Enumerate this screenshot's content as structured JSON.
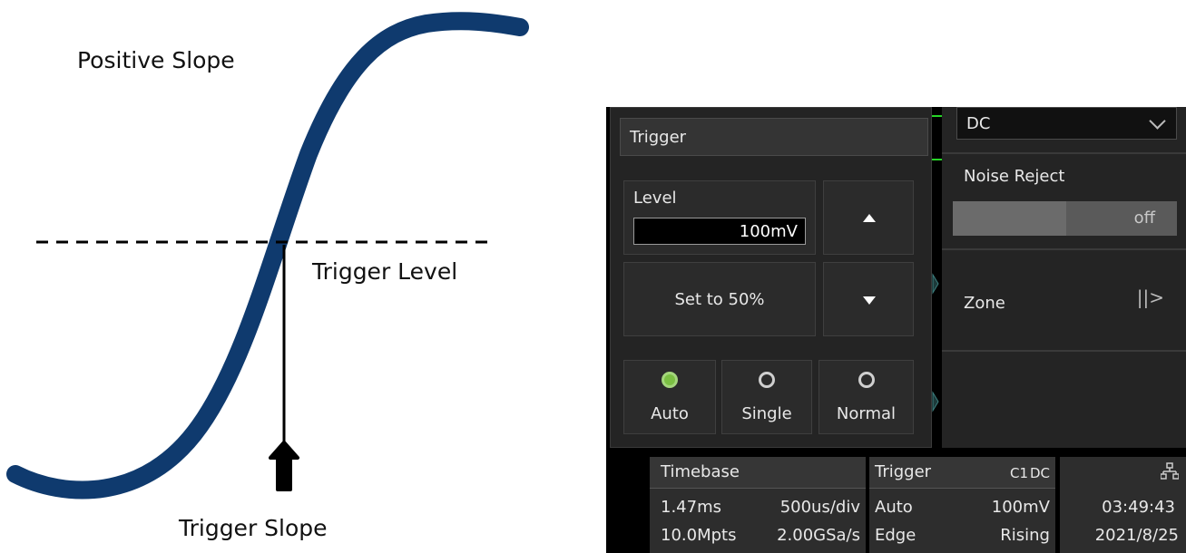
{
  "diagram": {
    "title": "Positive Slope",
    "level_label": "Trigger Level",
    "slope_label": "Trigger Slope"
  },
  "trigger_panel": {
    "title": "Trigger",
    "level_label": "Level",
    "level_value": "100mV",
    "set50_label": "Set to 50%",
    "modes": [
      {
        "label": "Auto",
        "selected": true
      },
      {
        "label": "Single",
        "selected": false
      },
      {
        "label": "Normal",
        "selected": false
      }
    ]
  },
  "right_panel": {
    "coupling_value": "DC",
    "noise_reject_label": "Noise Reject",
    "noise_reject_value": "off",
    "zone_label": "Zone",
    "zone_arrow": "||>"
  },
  "status_bar": {
    "timebase": {
      "title": "Timebase",
      "delay": "1.47ms",
      "scale": "500us/div",
      "memory": "10.0Mpts",
      "sample_rate": "2.00GSa/s"
    },
    "trigger": {
      "title": "Trigger",
      "source": "C1",
      "coupling": "DC",
      "mode": "Auto",
      "level": "100mV",
      "type": "Edge",
      "slope": "Rising"
    },
    "clock": {
      "time": "03:49:43",
      "date": "2021/8/25",
      "network_icon": "network-icon"
    }
  },
  "colors": {
    "curve": "#0f3a6e",
    "accent_yellow": "#f2e31f",
    "radio_on": "#7bc043",
    "panel_bg": "#242424"
  }
}
